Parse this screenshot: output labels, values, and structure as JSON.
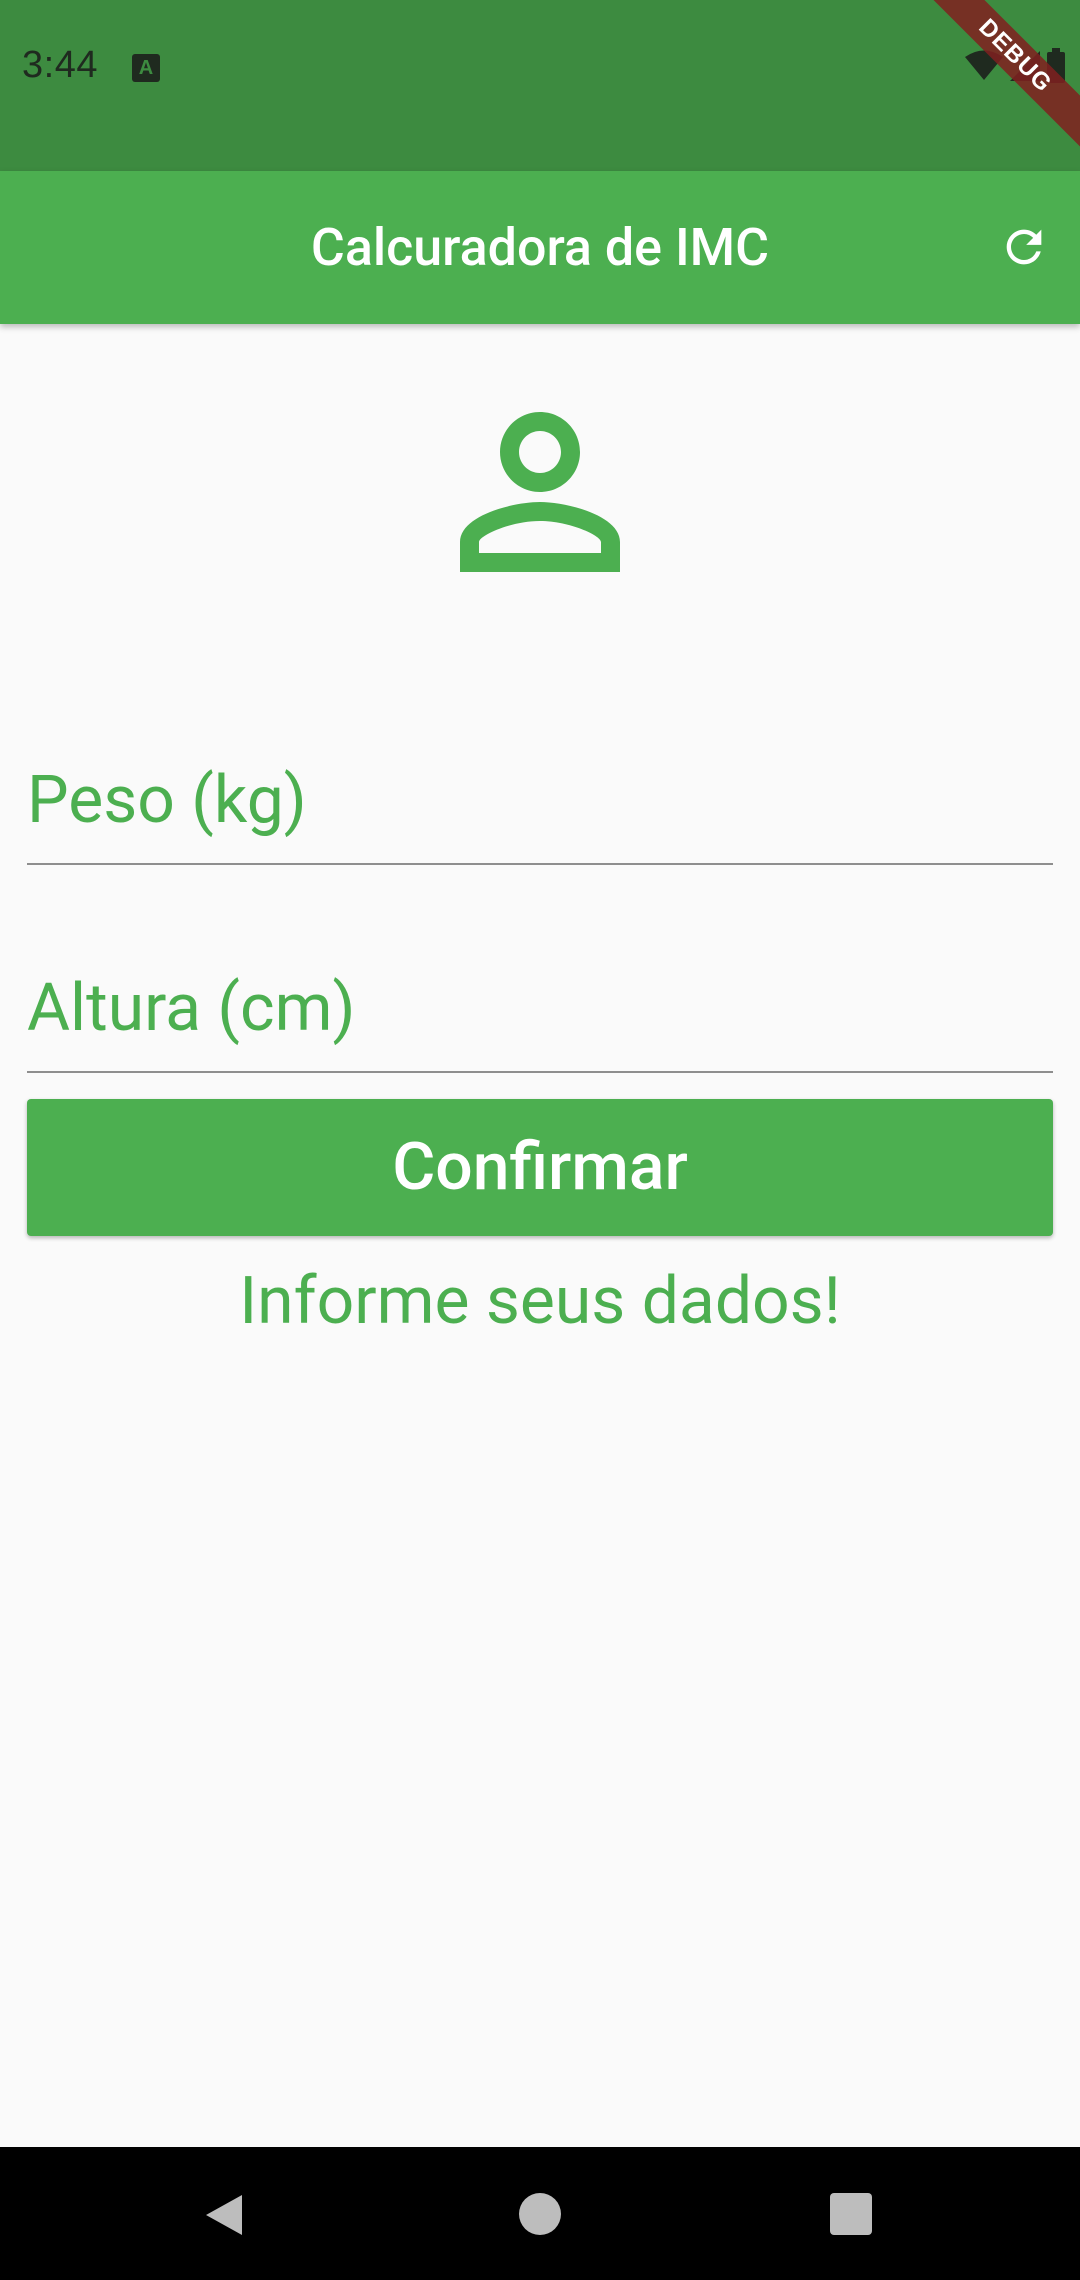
{
  "status_bar": {
    "time": "3:44",
    "notification_icon": "text-a-icon",
    "icons": [
      "wifi-icon",
      "cell-signal-icon",
      "battery-icon"
    ],
    "background_color": "#3d8b40"
  },
  "debug_banner": "DEBUG",
  "app_bar": {
    "title": "Calcuradora de IMC",
    "action_icon": "refresh-icon",
    "background_color": "#4caf50"
  },
  "main": {
    "avatar_icon": "person-icon",
    "weight_field": {
      "placeholder": "Peso (kg)",
      "value": ""
    },
    "height_field": {
      "placeholder": "Altura (cm)",
      "value": ""
    },
    "confirm_label": "Confirmar",
    "info_message": "Informe seus dados!",
    "accent_color": "#4caf50"
  },
  "nav_bar": {
    "buttons": [
      "back-icon",
      "home-icon",
      "recents-icon"
    ]
  }
}
